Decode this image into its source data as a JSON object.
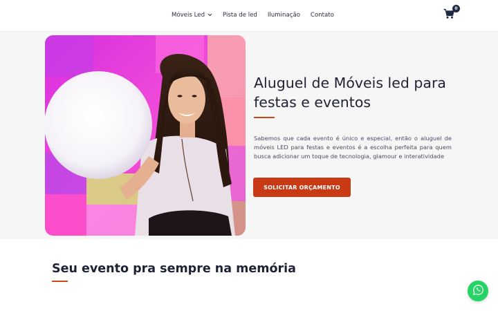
{
  "nav": {
    "items": [
      {
        "label": "Móveis Led",
        "has_dropdown": true
      },
      {
        "label": "Pista de led",
        "has_dropdown": false
      },
      {
        "label": "Iluminação",
        "has_dropdown": false
      },
      {
        "label": "Contato",
        "has_dropdown": false
      }
    ]
  },
  "cart": {
    "count": "0",
    "icon": "shopping-cart-icon"
  },
  "hero": {
    "title": "Aluguel de Móveis led para festas e eventos",
    "text": "Sabemos que cada evento é único e especial, então o aluguel de móveis LED para festas e eventos é a escolha perfeita para quem busca adicionar um toque de tecnologia, glamour e interatividade",
    "button_label": "SOLICITAR ORÇAMENTO",
    "image": "woman-with-glowing-led-sphere"
  },
  "section2": {
    "title": "Seu evento pra sempre na memória"
  },
  "whatsapp": {
    "icon": "whatsapp-icon"
  },
  "colors": {
    "accent": "#c83a14",
    "divider": "#cc4a1a",
    "whatsapp": "#25d366",
    "text_dark": "#1f2235"
  }
}
